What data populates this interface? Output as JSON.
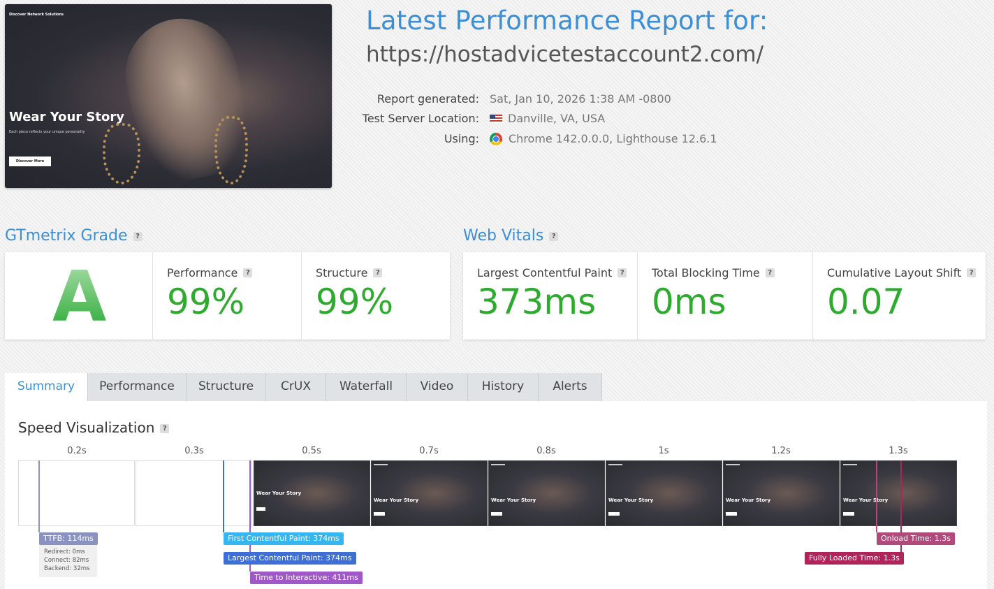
{
  "header": {
    "title": "Latest Performance Report for:",
    "url": "https://hostadvicetestaccount2.com/",
    "meta": [
      {
        "label": "Report generated:",
        "value": "Sat, Jan 10, 2026 1:38 AM -0800",
        "icon": ""
      },
      {
        "label": "Test Server Location:",
        "value": "Danville, VA, USA",
        "icon": "us-flag-icon"
      },
      {
        "label": "Using:",
        "value": "Chrome 142.0.0.0, Lighthouse 12.6.1",
        "icon": "chrome-icon"
      }
    ]
  },
  "screenshot": {
    "brand": "Discover Network Solutions",
    "headline": "Wear Your Story",
    "subtext": "Each piece reflects your unique personality",
    "button": "Discover More"
  },
  "gtmetrix": {
    "title": "GTmetrix Grade",
    "help": "?",
    "grade": "A",
    "performance_label": "Performance",
    "performance_value": "99%",
    "structure_label": "Structure",
    "structure_value": "99%"
  },
  "web_vitals": {
    "title": "Web Vitals",
    "help": "?",
    "items": [
      {
        "label": "Largest Contentful Paint",
        "value": "373ms"
      },
      {
        "label": "Total Blocking Time",
        "value": "0ms"
      },
      {
        "label": "Cumulative Layout Shift",
        "value": "0.07"
      }
    ]
  },
  "tabs": [
    "Summary",
    "Performance",
    "Structure",
    "CrUX",
    "Waterfall",
    "Video",
    "History",
    "Alerts"
  ],
  "active_tab": "Summary",
  "speed": {
    "title": "Speed Visualization",
    "help": "?",
    "times": [
      "0.2s",
      "0.3s",
      "0.5s",
      "0.7s",
      "0.8s",
      "1s",
      "1.2s",
      "1.3s"
    ],
    "frame_headline": "Wear Your Story",
    "markers": {
      "ttfb": "TTFB: 114ms",
      "fcp": "First Contentful Paint: 374ms",
      "lcp": "Largest Contentful Paint: 374ms",
      "tti": "Time to Interactive: 411ms",
      "onload": "Onload Time: 1.3s",
      "fully": "Fully Loaded Time: 1.3s"
    },
    "ttfb_detail": {
      "redirect": "Redirect: 0ms",
      "connect": "Connect: 82ms",
      "backend": "Backend: 32ms"
    }
  },
  "colors": {
    "accent": "#3a8fd6",
    "good": "#2eab2e",
    "ttfb": "#8a92c2",
    "fcp": "#35b6f0",
    "lcp": "#3d6fd6",
    "tti": "#a058c8",
    "onload": "#b04a7a",
    "fully": "#b0245a"
  }
}
